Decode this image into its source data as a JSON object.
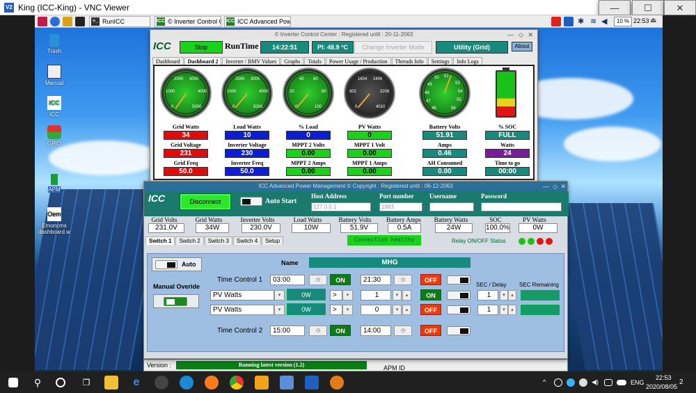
{
  "vnc": {
    "title": "King (ICC-King) - VNC Viewer",
    "logo": "V2",
    "min": "—",
    "max": "☐",
    "close": "✕"
  },
  "pi_taskbar": {
    "tasks": [
      "RunICC",
      "© Inverter Control Ce...",
      "ICC Advanced Power ..."
    ],
    "volume_label": "10 %",
    "clock": "22:53"
  },
  "desktop_icons": [
    {
      "label": "Trash"
    },
    {
      "label": "Manual"
    },
    {
      "label": "ICC"
    },
    {
      "label": "GPIO"
    },
    {
      "label": "APM"
    },
    {
      "label": "Emoncms dashboard.w"
    }
  ],
  "icc": {
    "title": "© Inverter Control Center : Registered until : 20-11-2063",
    "logo": "ICC",
    "stop": "Stop",
    "runtime": "RunTime",
    "time": "14:22:51",
    "pi_temp": "PI: 48.9 °C",
    "change_mode": "Change Inverter Mode",
    "utility": "Utility (Grid)",
    "about": "About",
    "tabs": [
      "Dashboard",
      "Dashboard 2",
      "Inverter / BMV Values",
      "Graphs",
      "Totals",
      "Power Usage / Production",
      "Threads Info",
      "Settings",
      "Info Logs"
    ],
    "gauges": [
      {
        "ticks": [
          "2000",
          "3000",
          "1000",
          "4000",
          "0",
          "5000"
        ]
      },
      {
        "ticks": [
          "2000",
          "3000",
          "1000",
          "4000",
          "0",
          "5000"
        ]
      },
      {
        "ticks": [
          "40",
          "60",
          "20",
          "80",
          "0",
          "100"
        ]
      },
      {
        "ticks": [
          "1604",
          "2406",
          "802",
          "3208",
          "0",
          "4010"
        ]
      },
      {
        "ticks": [
          "50",
          "51",
          "49",
          "53",
          "48",
          "54",
          "47",
          "55",
          "46",
          "56"
        ]
      }
    ],
    "labels": {
      "r1": [
        "Grid Watts",
        "Load Watts",
        "% Load",
        "PV Watts",
        "Battery Volts",
        "% SOC"
      ],
      "v1": [
        "34",
        "10",
        "0",
        "0",
        "51.91",
        "FULL"
      ],
      "r2": [
        "Grid Voltage",
        "Inverter Voltage",
        "MPPT 2 Volts",
        "MPPT 1 Volt",
        "Amps",
        "Watts"
      ],
      "v2": [
        "231",
        "230",
        "0.00",
        "0.00",
        "0.46",
        "24"
      ],
      "r3": [
        "Grid Freq",
        "Inverter Freq",
        "MPPT 2 Amps",
        "MPPT 1 Amps",
        "AH Consumed",
        "Time to go"
      ],
      "v3": [
        "50.0",
        "50.0",
        "0.00",
        "0.00",
        "0.00",
        "00:00"
      ]
    },
    "version_label": "Version :",
    "version": "Running latest version (1.2)",
    "apm_id": "APM ID"
  },
  "apm": {
    "title": "ICC Advanced Power Management          © Copyright : Registered until : 06-12-2063",
    "logo": "ICC",
    "disconnect": "Disconnect",
    "auto_start": "Auto Start",
    "host_label": "Host Address",
    "host_placeholder": "127.0.0.1",
    "port_label": "Port number",
    "port_placeholder": "1883",
    "user_label": "Username",
    "pass_label": "Password",
    "stats": [
      {
        "label": "Grid Volts",
        "value": "231.0V"
      },
      {
        "label": "Grid Watts",
        "value": "34W"
      },
      {
        "label": "Inverter Volts",
        "value": "230.0V"
      },
      {
        "label": "Load Watts",
        "value": "10W"
      },
      {
        "label": "Battery Volts",
        "value": "51.9V"
      },
      {
        "label": "Battery Amps",
        "value": "0.5A"
      },
      {
        "label": "Battery Watts",
        "value": "24W"
      },
      {
        "label": "SOC",
        "value": "100.0%"
      },
      {
        "label": "PV Watts",
        "value": "0W"
      }
    ],
    "tabs": [
      "Switch 1",
      "Switch 2",
      "Switch 3",
      "Switch 4",
      "Setup"
    ],
    "connection": "Connection healthy",
    "relay_status": "Relay ON/OFF Status",
    "relay_colors": [
      "#19c219",
      "#19c219",
      "#e21414",
      "#e21414"
    ],
    "auto": "Auto",
    "manual": "Manual Overide",
    "name_label": "Name",
    "name_value": "MHG",
    "tc1": "Time Control 1",
    "tc1_start": "03:00",
    "tc1_end": "21:30",
    "tc2": "Time Control 2",
    "tc2_start": "15:00",
    "tc2_end": "14:00",
    "on": "ON",
    "off": "OFF",
    "sel1": "PV Watts",
    "sel2": "PV Watts",
    "unit": "0W",
    "op": ">",
    "cmp1": "1",
    "cmp2": "0",
    "sec_delay_label": "SEC / Delay",
    "sec_remaining_label": "SEC Remaining",
    "delay1": "1",
    "delay2": "1"
  },
  "win_taskbar": {
    "lang": "ENG",
    "time": "22:53",
    "date": "2020/08/05",
    "notif": "2"
  }
}
